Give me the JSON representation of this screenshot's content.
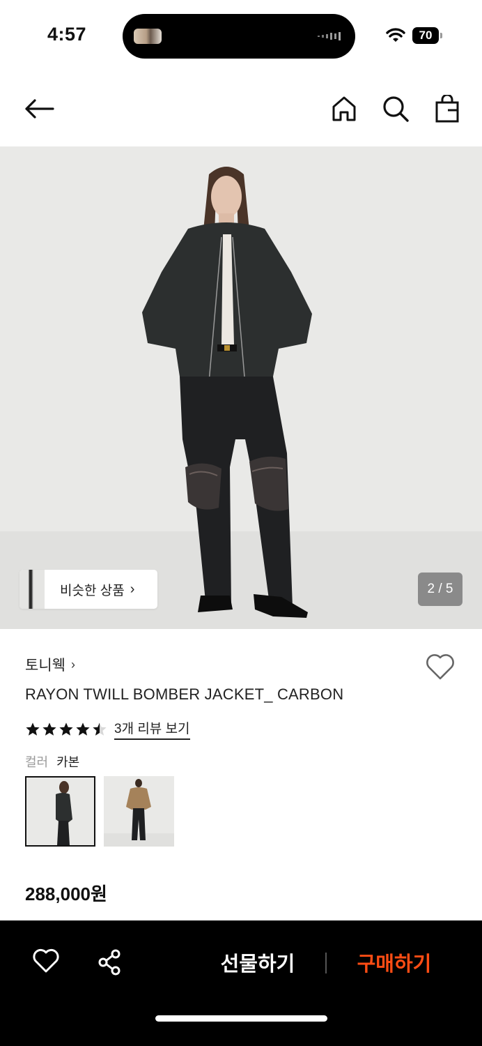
{
  "status_bar": {
    "time": "4:57",
    "battery": "70"
  },
  "nav": {
    "icons": [
      "arrow-left-icon",
      "home-icon",
      "search-icon",
      "shopping-bag-icon"
    ]
  },
  "gallery": {
    "similar_products_label": "비슷한 상품",
    "page_indicator": "2 / 5"
  },
  "product": {
    "brand": "토니웩",
    "title": "RAYON TWILL BOMBER JACKET_ CARBON",
    "rating": 4.5,
    "review_link": "3개 리뷰 보기",
    "color_label": "컬러",
    "color_value": "카본",
    "price": "288,000원"
  },
  "bottom_bar": {
    "gift_label": "선물하기",
    "buy_label": "구매하기",
    "buy_color": "#ff4d14"
  }
}
